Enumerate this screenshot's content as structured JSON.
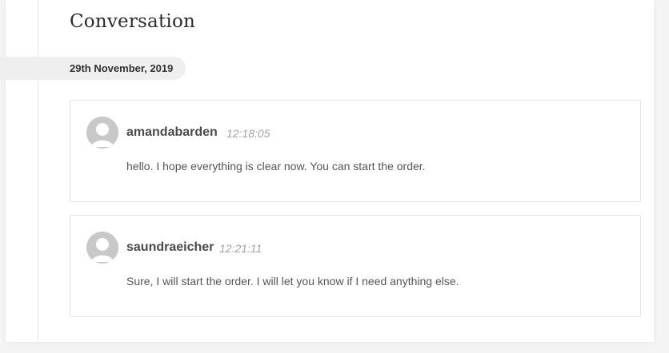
{
  "conversation": {
    "title": "Conversation",
    "date": "29th November, 2019",
    "messages": [
      {
        "username": "amandabarden",
        "time": "12:18:05",
        "text": "hello. I hope everything is clear now. You can start the order."
      },
      {
        "username": "saundraeicher",
        "time": "12:21:11",
        "text": "Sure, I will start the order. I will let you know if I need anything else."
      }
    ]
  },
  "colors": {
    "avatar": "#c8c8c8",
    "date_pill_bg": "#efefef",
    "timestamp": "#a3a3a3"
  }
}
